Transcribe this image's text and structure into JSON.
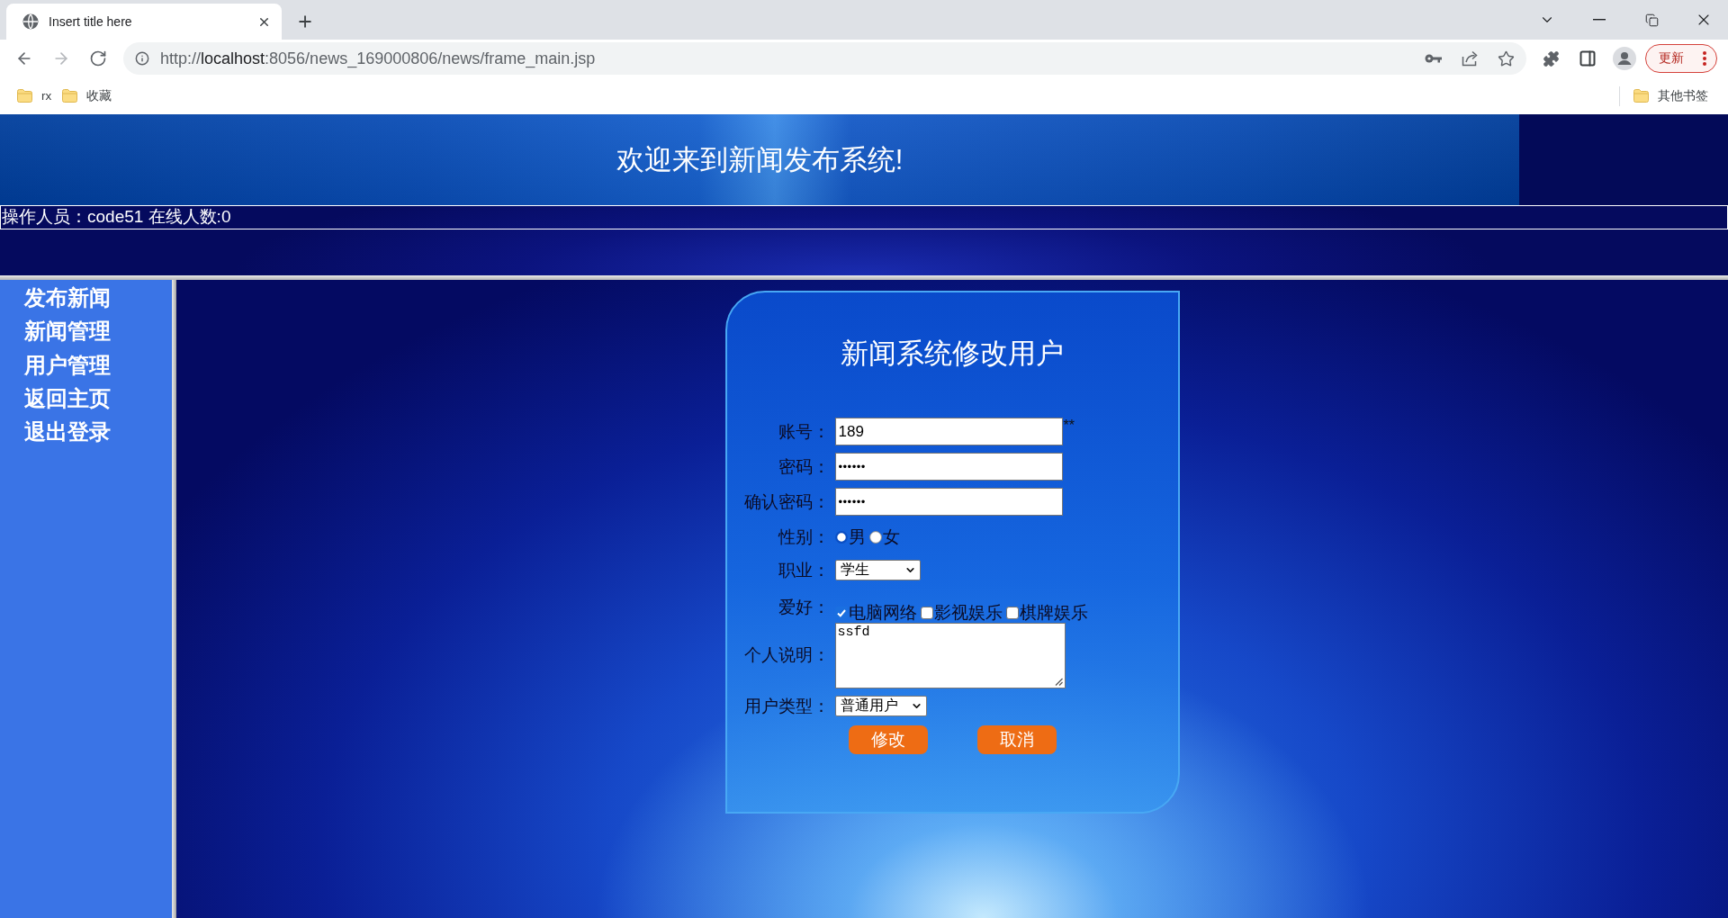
{
  "browser": {
    "tabs": [
      {
        "title": "Insert title here",
        "selected": true
      }
    ],
    "nav": [
      {
        "kind": "back",
        "disabled": false
      },
      {
        "kind": "forward",
        "disabled": true
      },
      {
        "kind": "reload",
        "disabled": false
      }
    ],
    "address": {
      "scheme": "http://",
      "host": "localhost",
      "path": ":8056/news_169000806/news/frame_main.jsp"
    },
    "update_button": "更新",
    "bookmarks": [
      {
        "label": "rx"
      },
      {
        "label": "收藏"
      }
    ],
    "other_bookmarks": "其他书签"
  },
  "header": {
    "title": "欢迎来到新闻发布系统!",
    "status": "操作人员：code51 在线人数:0"
  },
  "sidebar": {
    "items": [
      "发布新闻",
      "新闻管理",
      "用户管理",
      "返回主页",
      "退出登录"
    ]
  },
  "form": {
    "title": "新闻系统修改用户",
    "rows": [
      {
        "kind": "text",
        "label": "账号：",
        "value": "189",
        "note": "**"
      },
      {
        "kind": "password",
        "label": "密码：",
        "value": "••••••"
      },
      {
        "kind": "password",
        "label": "确认密码：",
        "value": "••••••"
      },
      {
        "kind": "radio",
        "label": "性别：",
        "options": [
          {
            "label": "男",
            "selected": true
          },
          {
            "label": "女",
            "selected": false
          }
        ]
      },
      {
        "kind": "select",
        "label": "职业：",
        "value": "学生"
      },
      {
        "kind": "checkbox",
        "label": "爱好：",
        "options": [
          {
            "label": "电脑网络",
            "checked": true
          },
          {
            "label": "影视娱乐",
            "checked": false
          },
          {
            "label": "棋牌娱乐",
            "checked": false
          }
        ]
      },
      {
        "kind": "textarea",
        "label": "个人说明：",
        "value": "ssfd"
      },
      {
        "kind": "select",
        "label": "用户类型：",
        "value": "普通用户"
      }
    ],
    "buttons": [
      "修改",
      "取消"
    ]
  }
}
